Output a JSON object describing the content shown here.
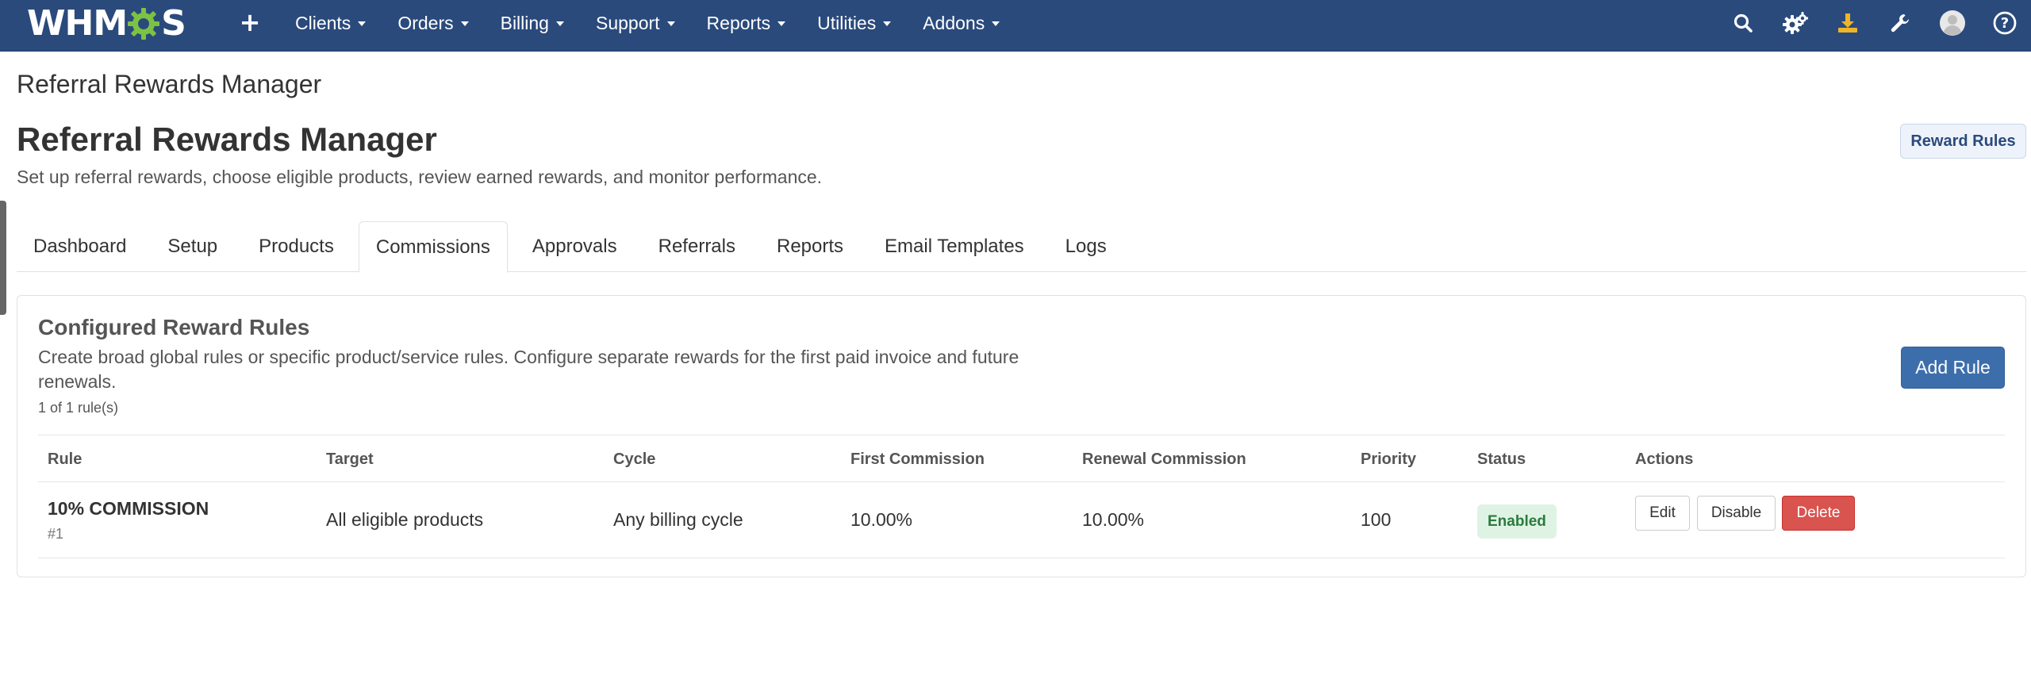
{
  "app": {
    "logo_text_left": "WHM",
    "logo_text_right": "S",
    "brand_color": "#2a4a7c",
    "accent_color": "#3d6eac"
  },
  "navbar": {
    "add_icon": "plus-icon",
    "menu": [
      {
        "label": "Clients"
      },
      {
        "label": "Orders"
      },
      {
        "label": "Billing"
      },
      {
        "label": "Support"
      },
      {
        "label": "Reports"
      },
      {
        "label": "Utilities"
      },
      {
        "label": "Addons"
      }
    ],
    "icons": [
      "search-icon",
      "gears-icon",
      "download-icon",
      "wrench-icon",
      "avatar-icon",
      "help-icon"
    ]
  },
  "page": {
    "breadcrumb_title": "Referral Rewards Manager",
    "title": "Referral Rewards Manager",
    "subtitle": "Set up referral rewards, choose eligible products, review earned rewards, and monitor performance.",
    "reward_rules_button": "Reward Rules"
  },
  "tabs": [
    {
      "label": "Dashboard",
      "active": false
    },
    {
      "label": "Setup",
      "active": false
    },
    {
      "label": "Products",
      "active": false
    },
    {
      "label": "Commissions",
      "active": true
    },
    {
      "label": "Approvals",
      "active": false
    },
    {
      "label": "Referrals",
      "active": false
    },
    {
      "label": "Reports",
      "active": false
    },
    {
      "label": "Email Templates",
      "active": false
    },
    {
      "label": "Logs",
      "active": false
    }
  ],
  "rules_card": {
    "title": "Configured Reward Rules",
    "description": "Create broad global rules or specific product/service rules. Configure separate rewards for the first paid invoice and future renewals.",
    "count_text": "1 of 1 rule(s)",
    "add_button": "Add Rule",
    "columns": [
      "Rule",
      "Target",
      "Cycle",
      "First Commission",
      "Renewal Commission",
      "Priority",
      "Status",
      "Actions"
    ],
    "rows": [
      {
        "rule": "10% COMMISSION",
        "id": "#1",
        "target": "All eligible products",
        "cycle": "Any billing cycle",
        "first_commission": "10.00%",
        "renewal_commission": "10.00%",
        "priority": "100",
        "status": "Enabled",
        "actions": {
          "edit": "Edit",
          "disable": "Disable",
          "delete": "Delete"
        }
      }
    ]
  }
}
